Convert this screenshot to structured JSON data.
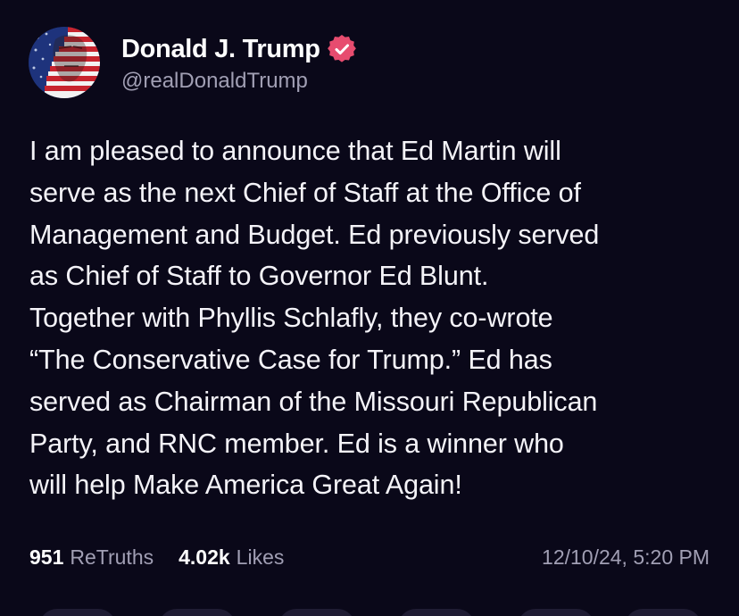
{
  "author": {
    "display_name": "Donald J. Trump",
    "handle": "@realDonaldTrump",
    "avatar_icon": "user-avatar",
    "verified_icon": "verified-badge-icon",
    "verified_color": "#e74c6f"
  },
  "post": {
    "text": "I am pleased to announce that Ed Martin will\nserve as the next Chief of Staff at the Office of\nManagement and Budget. Ed previously served\nas Chief of Staff to Governor Ed Blunt.\nTogether with Phyllis Schlafly, they co-wrote\n“The Conservative Case for Trump.” Ed has\nserved as Chairman of the Missouri Republican\nParty, and RNC member. Ed is a winner who\nwill help Make America Great Again!"
  },
  "stats": {
    "retruths_count": "951",
    "retruths_label": "ReTruths",
    "likes_count": "4.02k",
    "likes_label": "Likes"
  },
  "timestamp": "12/10/24, 5:20 PM",
  "colors": {
    "background": "#0a0819",
    "text_primary": "#f4f3f8",
    "text_secondary": "#a19fb4"
  }
}
